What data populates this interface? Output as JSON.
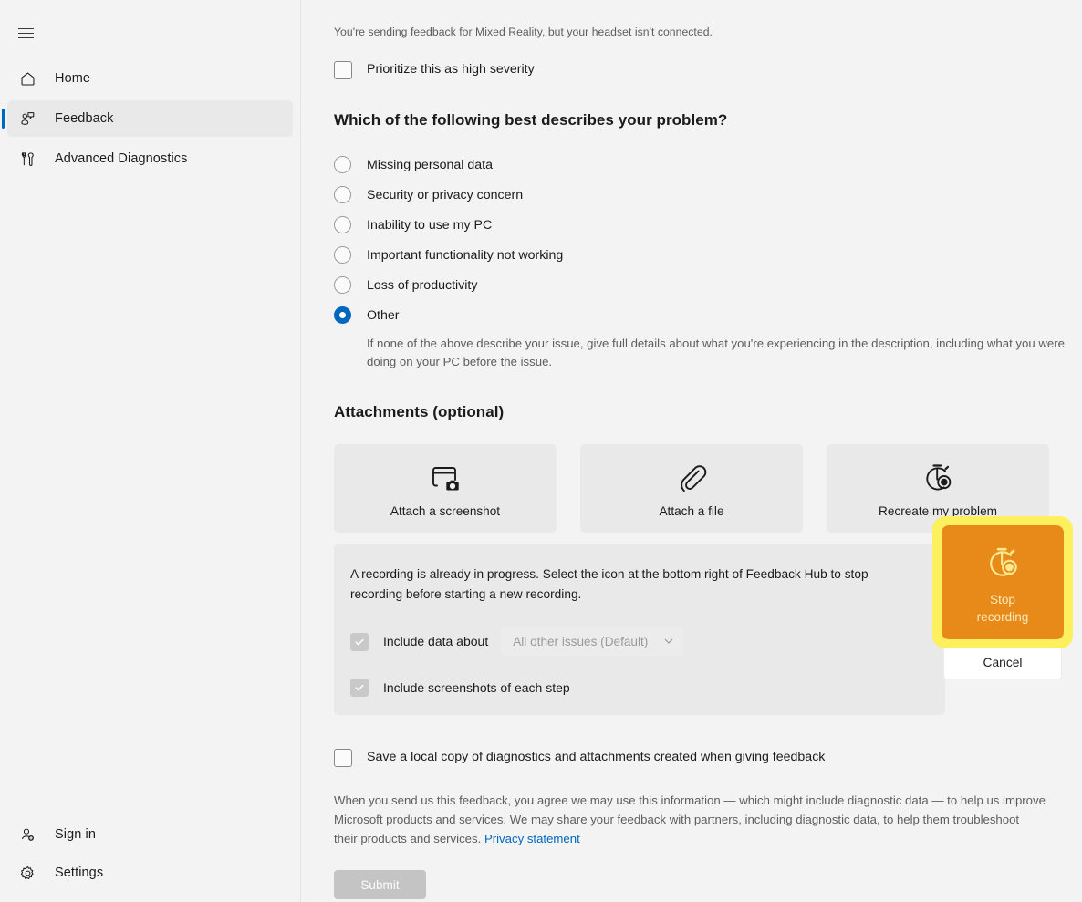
{
  "sidebar": {
    "menu_icon": "hamburger-icon",
    "items": [
      {
        "label": "Home",
        "icon": "home-icon"
      },
      {
        "label": "Feedback",
        "icon": "feedback-icon"
      },
      {
        "label": "Advanced Diagnostics",
        "icon": "diagnostics-icon"
      }
    ],
    "bottom_items": [
      {
        "label": "Sign in",
        "icon": "person-add-icon"
      },
      {
        "label": "Settings",
        "icon": "gear-icon"
      }
    ]
  },
  "main": {
    "notice": "You're sending feedback for Mixed Reality, but your headset isn't connected.",
    "prioritize_label": "Prioritize this as high severity",
    "problem_heading": "Which of the following best describes your problem?",
    "problem_options": [
      "Missing personal data",
      "Security or privacy concern",
      "Inability to use my PC",
      "Important functionality not working",
      "Loss of productivity",
      "Other"
    ],
    "selected_option": "Other",
    "other_help": "If none of the above describe your issue, give full details about what you're experiencing in the description, including what you were doing on your PC before the issue.",
    "attachments_heading": "Attachments (optional)",
    "attachment_tiles": [
      {
        "label": "Attach a screenshot",
        "icon": "screenshot-icon"
      },
      {
        "label": "Attach a file",
        "icon": "paperclip-icon"
      },
      {
        "label": "Recreate my problem",
        "icon": "stopwatch-record-icon"
      }
    ],
    "recording": {
      "message": "A recording is already in progress. Select the icon at the bottom right of Feedback Hub to stop recording before starting a new recording.",
      "include_data_label": "Include data about",
      "dropdown_value": "All other issues (Default)",
      "dropdown_chevron": "chevron-down-icon",
      "include_screenshots_label": "Include screenshots of each step"
    },
    "stop_recording": {
      "label": "Stop\nrecording",
      "line1": "Stop",
      "line2": "recording",
      "icon": "stopwatch-record-icon",
      "cancel_label": "Cancel",
      "button_color": "#e88a1a",
      "highlight_color": "#fdf05e"
    },
    "save_copy_label": "Save a local copy of diagnostics and attachments created when giving feedback",
    "legal_text": "When you send us this feedback, you agree we may use this information — which might include diagnostic data — to help us improve Microsoft products and services. We may share your feedback with partners, including diagnostic data, to help them troubleshoot their products and services.",
    "privacy_link": "Privacy statement",
    "submit_label": "Submit"
  },
  "colors": {
    "accent": "#0067c0",
    "app_bg": "#f3f3f3",
    "panel_bg": "#e9e9e9",
    "link": "#0067c0"
  }
}
